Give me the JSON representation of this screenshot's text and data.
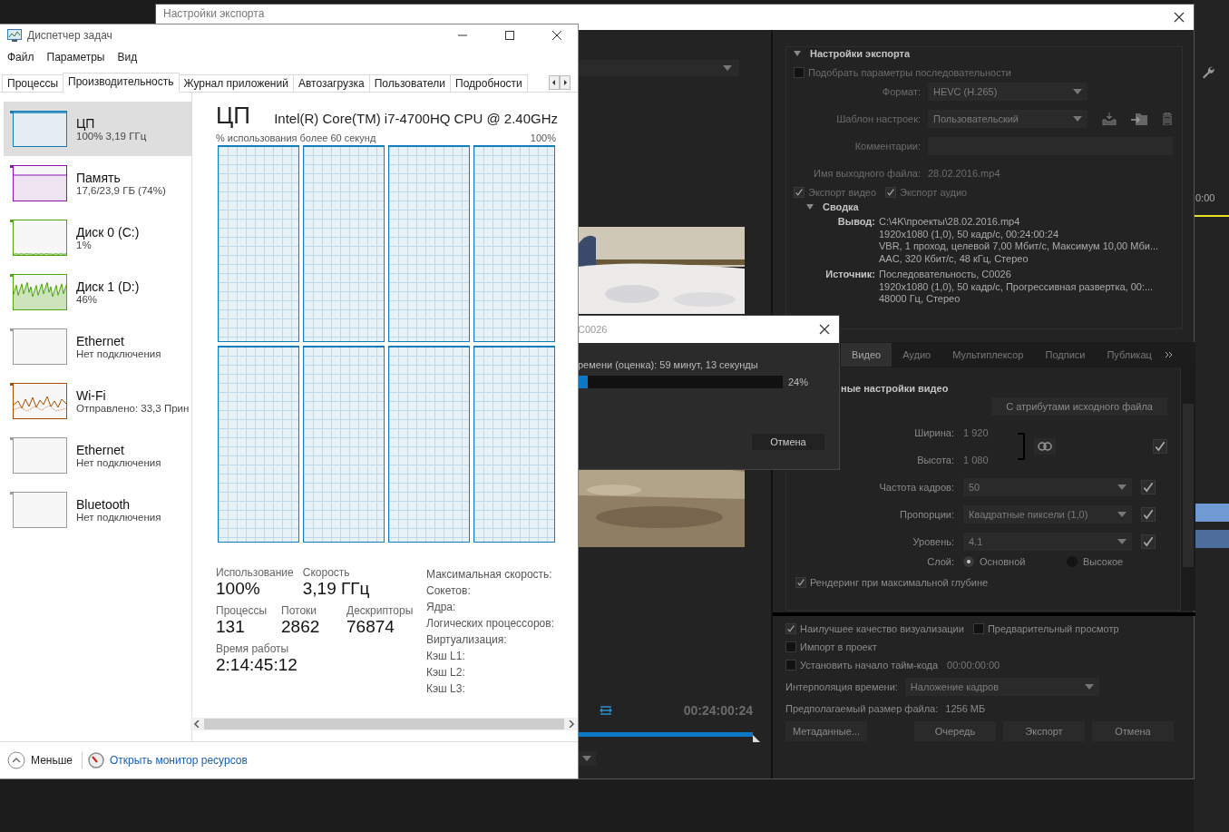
{
  "export_window": {
    "title": "Настройки экспорта"
  },
  "source_preview": {
    "timecode": "00:24:00:24"
  },
  "progress_dialog": {
    "title": "C0026",
    "message": "ремени (оценка): 59 минут, 13 секунды",
    "level": 0.05,
    "percent": "24%",
    "cancel": "Отмена"
  },
  "export_settings": {
    "heading": "Настройки экспорта",
    "match_sequence": {
      "label": "Подобрать параметры последовательности",
      "checked": false
    },
    "fields": [
      {
        "label": "Формат:",
        "value": "HEVC (H.265)",
        "kind": "dropdown"
      },
      {
        "label": "Шаблон настроек:",
        "value": "Пользовательский",
        "kind": "preset"
      },
      {
        "label": "Комментарии:",
        "kind": "text"
      },
      {
        "label": "Имя выходного файла:",
        "value": "28.02.2016.mp4",
        "kind": "link"
      }
    ],
    "export_checks": [
      {
        "label": "Экспорт видео",
        "checked": true
      },
      {
        "label": "Экспорт аудио",
        "checked": true
      }
    ],
    "summary": {
      "heading": "Сводка",
      "groups": [
        {
          "label": "Вывод:",
          "lines": [
            "C:\\4K\\проекты\\28.02.2016.mp4",
            "1920x1080 (1,0), 50 кадр/с, 00:24:00:24",
            "VBR, 1 проход, целевой 7,00 Мбит/с, Максимум 10,00 Мби...",
            "AAC, 320 Кбит/с, 48 кГц, Стерео"
          ]
        },
        {
          "label": "Источник:",
          "lines": [
            "Последовательность, C0026",
            "1920x1080 (1,0), 50 кадр/с, Прогрессивная развертка, 00:...",
            "48000 Гц, Стерео"
          ]
        }
      ]
    }
  },
  "tabs": [
    {
      "label": "Видео",
      "selected": true
    },
    {
      "label": "Аудио",
      "selected": false
    },
    {
      "label": "Мультиплексор",
      "selected": false
    },
    {
      "label": "Подписи",
      "selected": false
    },
    {
      "label": "Публикац",
      "selected": false
    }
  ],
  "video": {
    "heading": "ные настройки видео",
    "match_button": "С атрибутами исходного файла",
    "width": {
      "label": "Ширина:",
      "value": "1 920"
    },
    "height": {
      "label": "Высота:",
      "value": "1 080"
    },
    "size_checked": true,
    "rows": [
      {
        "label": "Частота кадров:",
        "value": "50",
        "checked": true
      },
      {
        "label": "Пропорции:",
        "value": "Квадратные пиксели (1,0)",
        "checked": true
      },
      {
        "label": "Уровень:",
        "value": "4.1",
        "checked": true
      }
    ],
    "tier": {
      "label": "Слой:",
      "options": [
        {
          "label": "Основной",
          "selected": true
        },
        {
          "label": "Высокое",
          "selected": false
        }
      ]
    },
    "max_depth": {
      "label": "Рендеринг при максимальной глубине",
      "checked": true
    }
  },
  "bottom": {
    "checks": [
      {
        "label": "Наилучшее качество визуализации",
        "checked": true
      },
      {
        "label": "Предварительный просмотр",
        "checked": false
      }
    ],
    "checks2": [
      {
        "label": "Импорт в проект",
        "checked": false
      },
      {
        "label": "Установить начало тайм-кода",
        "checked": false,
        "value": "00:00:00:00"
      }
    ],
    "interpolation": {
      "label": "Интерполяция времени:",
      "value": "Наложение кадров"
    },
    "file_size": {
      "label": "Предполагаемый размер файла:",
      "value": "1256 МБ"
    },
    "buttons": [
      "Метаданные...",
      "Очередь",
      "Экспорт",
      "Отмена"
    ]
  },
  "background_timeline": {
    "timecode": "0:00"
  },
  "task_manager": {
    "title": "Диспетчер задач",
    "menu": [
      "Файл",
      "Параметры",
      "Вид"
    ],
    "tabs": [
      {
        "label": "Процессы",
        "selected": false
      },
      {
        "label": "Производительность",
        "selected": true
      },
      {
        "label": "Журнал приложений",
        "selected": false
      },
      {
        "label": "Автозагрузка",
        "selected": false
      },
      {
        "label": "Пользователи",
        "selected": false
      },
      {
        "label": "Подробности",
        "selected": false
      }
    ],
    "resources": [
      {
        "name": "ЦП",
        "detail": "100% 3,19 ГГц",
        "kind": "full",
        "color": "#117dbb",
        "selected": true
      },
      {
        "name": "Память",
        "detail": "17,6/23,9 ГБ (74%)",
        "kind": "memory",
        "color": "#8b12ae",
        "selected": false
      },
      {
        "name": "Диск 0 (C:)",
        "detail": "1%",
        "kind": "idle",
        "color": "#4da60c",
        "selected": false
      },
      {
        "name": "Диск 1 (D:)",
        "detail": "46%",
        "kind": "busy",
        "color": "#4da60c",
        "selected": false
      },
      {
        "name": "Ethernet",
        "detail": "Нет подключения",
        "kind": "empty",
        "color": "#9a9a9a",
        "selected": false
      },
      {
        "name": "Wi-Fi",
        "detail": "Отправлено: 33,3 Прин",
        "kind": "network",
        "color": "#a74f01",
        "selected": false
      },
      {
        "name": "Ethernet",
        "detail": "Нет подключения",
        "kind": "empty",
        "color": "#9a9a9a",
        "selected": false
      },
      {
        "name": "Bluetooth",
        "detail": "Нет подключения",
        "kind": "empty",
        "color": "#9a9a9a",
        "selected": false
      }
    ],
    "cpu": {
      "heading": "ЦП",
      "model": "Intel(R) Core(TM) i7-4700HQ CPU @ 2.40GHz",
      "caption": "% использования более 60 секунд",
      "max": "100%",
      "cores": [
        {
          "level": 1
        },
        {
          "level": 1
        },
        {
          "level": 1
        },
        {
          "level": 1
        },
        {
          "level": 1
        },
        {
          "level": 1
        },
        {
          "level": 1
        },
        {
          "level": 1
        }
      ],
      "stats": [
        [
          {
            "label": "Использование",
            "value": "100%"
          },
          {
            "label": "Скорость",
            "value": "3,19 ГГц"
          }
        ],
        [
          {
            "label": "Процессы",
            "value": "131"
          },
          {
            "label": "Потоки",
            "value": "2862"
          },
          {
            "label": "Дескрипторы",
            "value": "76874"
          }
        ],
        [
          {
            "label": "Время работы",
            "value": "2:14:45:12"
          }
        ]
      ],
      "specs": [
        "Максимальная скорость:",
        "Сокетов:",
        "Ядра:",
        "Логических процессоров:",
        "Виртуализация:",
        "Кэш L1:",
        "Кэш L2:",
        "Кэш L3:"
      ]
    },
    "footer": {
      "less": "Меньше",
      "monitor_link": "Открыть монитор ресурсов"
    }
  }
}
